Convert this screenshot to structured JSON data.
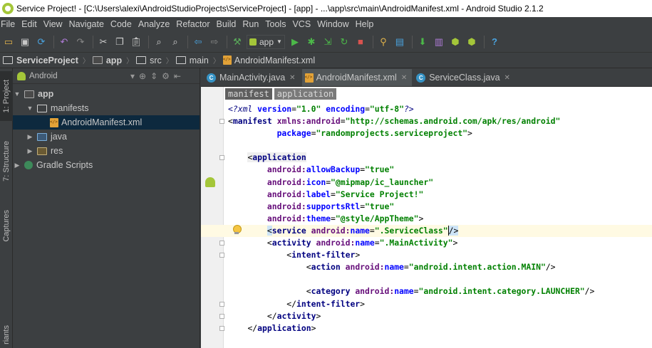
{
  "window": {
    "title": "Service Project! - [C:\\Users\\alexi\\AndroidStudioProjects\\ServiceProject] - [app] - ...\\app\\src\\main\\AndroidManifest.xml - Android Studio 2.1.2"
  },
  "menu": [
    "File",
    "Edit",
    "View",
    "Navigate",
    "Code",
    "Analyze",
    "Refactor",
    "Build",
    "Run",
    "Tools",
    "VCS",
    "Window",
    "Help"
  ],
  "toolbar": {
    "run_config": "app",
    "icons": [
      "open-icon",
      "save-icon",
      "sync-icon",
      "undo-icon",
      "redo-icon",
      "cut-icon",
      "copy-icon",
      "paste-icon",
      "find-icon",
      "replace-icon",
      "back-icon",
      "forward-icon",
      "make-icon",
      "run-icon",
      "debug-icon",
      "attach-icon",
      "apply-changes-icon",
      "stop-icon",
      "structure-icon",
      "sdk-icon",
      "avd-manager-icon",
      "sdk-manager-icon",
      "android-monitor-icon",
      "help-icon"
    ]
  },
  "navbar": {
    "crumbs": [
      "ServiceProject",
      "app",
      "src",
      "main",
      "AndroidManifest.xml"
    ]
  },
  "left_strip": {
    "project_tab": "1: Project",
    "structure_tab": "7: Structure",
    "captures_tab": "Captures",
    "variants_tab": "riants"
  },
  "project_panel": {
    "view": "Android",
    "tree": [
      {
        "label": "app",
        "level": 0,
        "expanded": true,
        "kind": "module"
      },
      {
        "label": "manifests",
        "level": 1,
        "expanded": true,
        "kind": "folder"
      },
      {
        "label": "AndroidManifest.xml",
        "level": 2,
        "kind": "xml",
        "selected": true
      },
      {
        "label": "java",
        "level": 1,
        "expanded": false,
        "kind": "folder"
      },
      {
        "label": "res",
        "level": 1,
        "expanded": false,
        "kind": "res"
      },
      {
        "label": "Gradle Scripts",
        "level": 0,
        "expanded": false,
        "kind": "gradle"
      }
    ]
  },
  "tabs": [
    {
      "label": "MainActivity.java",
      "kind": "class",
      "active": false
    },
    {
      "label": "AndroidManifest.xml",
      "kind": "xml",
      "active": true
    },
    {
      "label": "ServiceClass.java",
      "kind": "class",
      "active": false
    }
  ],
  "xml_breadcrumb": [
    "manifest",
    "application"
  ],
  "code": {
    "l1": {
      "pi_open": "<?",
      "pi_name": "xml",
      "a1": "version",
      "v1": "\"1.0\"",
      "a2": "encoding",
      "v2": "\"utf-8\"",
      "pi_close": "?>"
    },
    "l2": {
      "tag": "manifest",
      "ns": "xmlns:android",
      "val": "\"http://schemas.android.com/apk/res/android\""
    },
    "l3": {
      "attr": "package",
      "val": "\"randomprojects.serviceproject\""
    },
    "l5": {
      "tag": "application"
    },
    "attrs": [
      {
        "name": "allowBackup",
        "val": "\"true\""
      },
      {
        "name": "icon",
        "val": "\"@mipmap/ic_launcher\""
      },
      {
        "name": "label",
        "val": "\"Service Project!\""
      },
      {
        "name": "supportsRtl",
        "val": "\"true\""
      },
      {
        "name": "theme",
        "val": "\"@style/AppTheme\""
      }
    ],
    "ns_prefix": "android",
    "service": {
      "tag": "service",
      "attr": "name",
      "val": "\".ServiceClass\""
    },
    "activity": {
      "tag": "activity",
      "attr": "name",
      "val": "\".MainActivity\""
    },
    "intent_filter": {
      "tag": "intent-filter"
    },
    "action": {
      "tag": "action",
      "attr": "name",
      "val": "\"android.intent.action.MAIN\""
    },
    "category": {
      "tag": "category",
      "attr": "name",
      "val": "\"android.intent.category.LAUNCHER\""
    },
    "close_intent": "intent-filter",
    "close_activity": "activity",
    "close_application": "application"
  }
}
